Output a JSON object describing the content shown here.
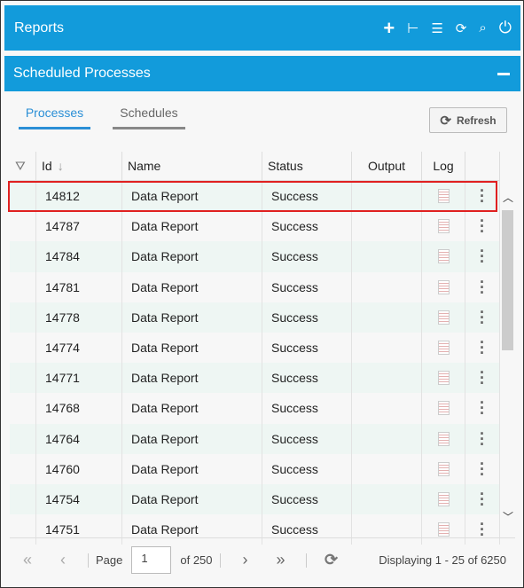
{
  "header": {
    "title": "Reports",
    "icons": [
      "plus-icon",
      "collapse-list-icon",
      "tree-list-icon",
      "sync-icon",
      "search-icon",
      "power-icon"
    ]
  },
  "panel": {
    "title": "Scheduled Processes"
  },
  "tabs": [
    {
      "label": "Processes",
      "active": true
    },
    {
      "label": "Schedules",
      "active": false
    }
  ],
  "refresh_label": "Refresh",
  "columns": [
    "Id",
    "Name",
    "Status",
    "Output",
    "Log"
  ],
  "rows": [
    {
      "id": "14812",
      "name": "Data Report",
      "status": "Success"
    },
    {
      "id": "14787",
      "name": "Data Report",
      "status": "Success"
    },
    {
      "id": "14784",
      "name": "Data Report",
      "status": "Success"
    },
    {
      "id": "14781",
      "name": "Data Report",
      "status": "Success"
    },
    {
      "id": "14778",
      "name": "Data Report",
      "status": "Success"
    },
    {
      "id": "14774",
      "name": "Data Report",
      "status": "Success"
    },
    {
      "id": "14771",
      "name": "Data Report",
      "status": "Success"
    },
    {
      "id": "14768",
      "name": "Data Report",
      "status": "Success"
    },
    {
      "id": "14764",
      "name": "Data Report",
      "status": "Success"
    },
    {
      "id": "14760",
      "name": "Data Report",
      "status": "Success"
    },
    {
      "id": "14754",
      "name": "Data Report",
      "status": "Success"
    },
    {
      "id": "14751",
      "name": "Data Report",
      "status": "Success"
    }
  ],
  "pager": {
    "page_label": "Page",
    "page": "1",
    "of_label": "of 250",
    "display": "Displaying 1 - 25 of 6250"
  }
}
